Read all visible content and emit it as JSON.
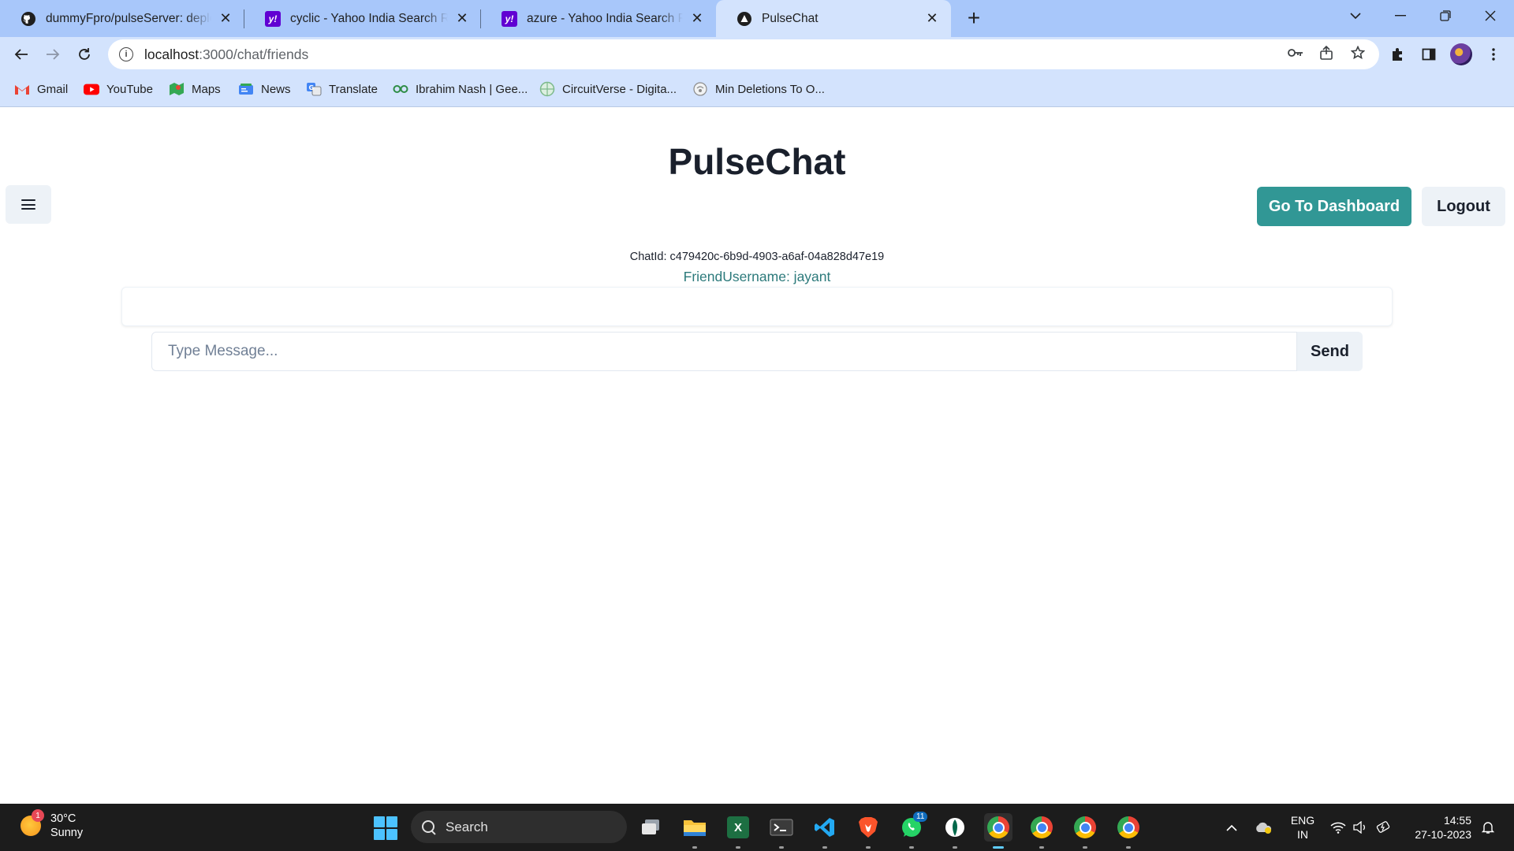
{
  "browser": {
    "tabs": [
      {
        "title": "dummyFpro/pulseServer: deploy",
        "icon": "github-icon",
        "active": false
      },
      {
        "title": "cyclic - Yahoo India Search Results",
        "icon": "yahoo-icon",
        "active": false
      },
      {
        "title": "azure - Yahoo India Search Results",
        "icon": "yahoo-icon",
        "active": false
      },
      {
        "title": "PulseChat",
        "icon": "pulsechat-icon",
        "active": true
      }
    ],
    "new_tab_symbol": "+",
    "address": {
      "host": "localhost",
      "path": ":3000/chat/friends"
    },
    "bookmarks": [
      {
        "label": "Gmail",
        "icon": "gmail-icon"
      },
      {
        "label": "YouTube",
        "icon": "youtube-icon"
      },
      {
        "label": "Maps",
        "icon": "maps-icon"
      },
      {
        "label": "News",
        "icon": "news-icon"
      },
      {
        "label": "Translate",
        "icon": "translate-icon"
      },
      {
        "label": "Ibrahim Nash | Gee...",
        "icon": "geeksforgeeks-icon"
      },
      {
        "label": "CircuitVerse - Digita...",
        "icon": "circuitverse-icon"
      },
      {
        "label": "Min Deletions To O...",
        "icon": "globe-icon"
      }
    ]
  },
  "app": {
    "title": "PulseChat",
    "dashboard_button": "Go To Dashboard",
    "logout_button": "Logout",
    "chat_id_text": "ChatId: c479420c-6b9d-4903-a6af-04a828d47e19",
    "friend_text": "FriendUsername: jayant",
    "message_placeholder": "Type Message...",
    "send_button": "Send",
    "colors": {
      "accent": "#319795",
      "friend_text": "#2c7a7b",
      "button_bg": "#edf2f7"
    }
  },
  "taskbar": {
    "weather": {
      "temp": "30°C",
      "condition": "Sunny",
      "badge": "1"
    },
    "search_label": "Search",
    "whatsapp_badge": "11",
    "language": {
      "line1": "ENG",
      "line2": "IN"
    },
    "time": "14:55",
    "date": "27-10-2023"
  }
}
